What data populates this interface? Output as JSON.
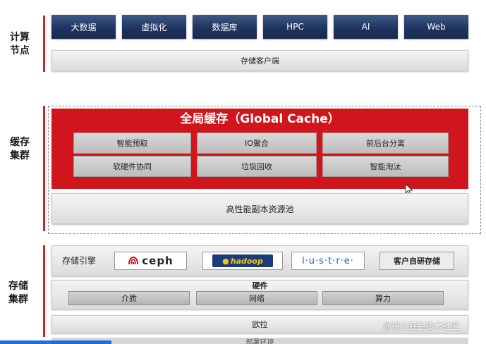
{
  "compute": {
    "label": "计算\n节点",
    "tiles": [
      "大数据",
      "虚拟化",
      "数据库",
      "HPC",
      "AI",
      "Web"
    ],
    "client": "存储客户端"
  },
  "cache": {
    "label": "缓存\n集群",
    "title": "全局缓存（Global Cache）",
    "cells": [
      "智能预取",
      "IO聚合",
      "前后台分离",
      "软硬件协同",
      "垃圾回收",
      "智能淘汰"
    ],
    "pool": "高性能副本资源池"
  },
  "storage": {
    "label": "存储\n集群",
    "engine_label": "存储引擎",
    "engines": [
      "ceph",
      "hadoop",
      "l·u·s·t·r·e·",
      "客户自研存储"
    ],
    "hardware_title": "硬件",
    "hardware": [
      "介质",
      "网络",
      "算力"
    ],
    "bottom": "欧拉",
    "cut_off": "部署环境"
  },
  "watermark": "@稀土掘金技术社区",
  "colors": {
    "accent": "#d0151c",
    "tile": "#1f3461"
  }
}
